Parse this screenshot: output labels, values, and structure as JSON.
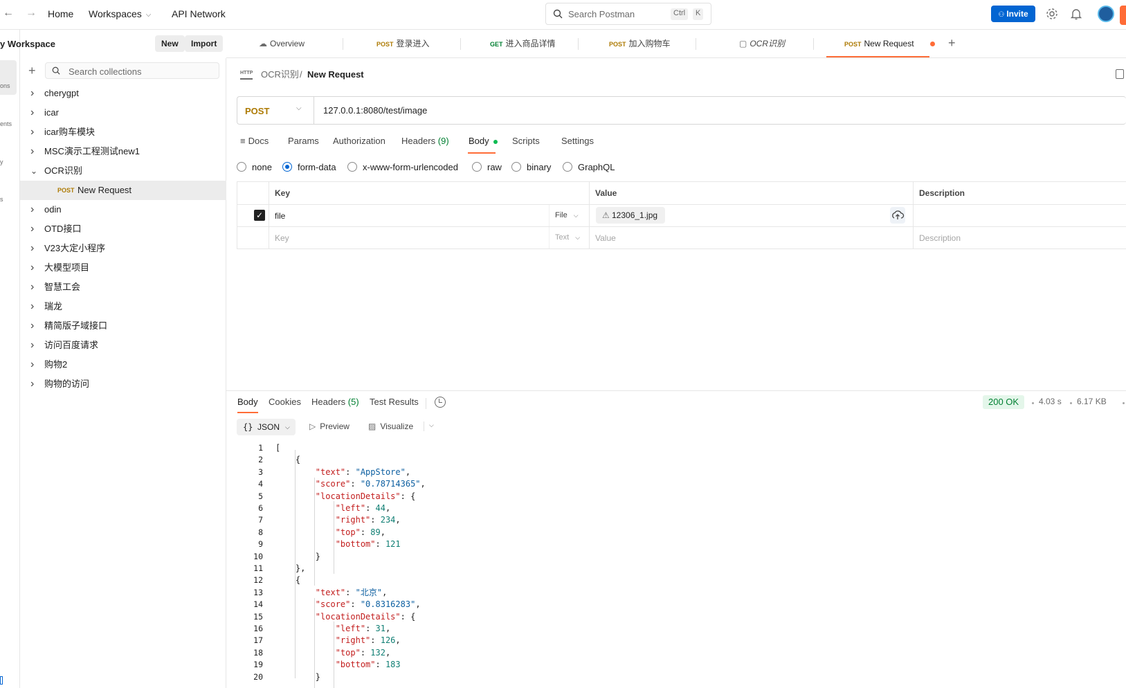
{
  "topbar": {
    "nav": [
      "Home",
      "Workspaces",
      "API Network"
    ],
    "search_placeholder": "Search Postman",
    "shortcut": [
      "Ctrl",
      "K"
    ],
    "invite_label": "Invite"
  },
  "sidebar": {
    "workspace_title": "y Workspace",
    "new_label": "New",
    "import_label": "Import",
    "rail_labels": [
      "ons",
      "ents",
      "y",
      "s"
    ],
    "search_placeholder": "Search collections",
    "collections": [
      {
        "name": "cherygpt",
        "expanded": false
      },
      {
        "name": "icar",
        "expanded": false
      },
      {
        "name": "icar购车模块",
        "expanded": false
      },
      {
        "name": "MSC演示工程测试new1",
        "expanded": false
      },
      {
        "name": "OCR识别",
        "expanded": true,
        "children": [
          {
            "method": "POST",
            "name": "New Request"
          }
        ]
      },
      {
        "name": "odin",
        "expanded": false
      },
      {
        "name": "OTD接口",
        "expanded": false
      },
      {
        "name": "V23大定小程序",
        "expanded": false
      },
      {
        "name": "大模型项目",
        "expanded": false
      },
      {
        "name": "智慧工会",
        "expanded": false
      },
      {
        "name": "瑞龙",
        "expanded": false
      },
      {
        "name": "精简版子域接口",
        "expanded": false
      },
      {
        "name": "访问百度请求",
        "expanded": false
      },
      {
        "name": "购物2",
        "expanded": false
      },
      {
        "name": "购物的访问",
        "expanded": false
      }
    ]
  },
  "tabs": [
    {
      "method": "",
      "label": "Overview"
    },
    {
      "method": "POST",
      "label": "登录进入"
    },
    {
      "method": "GET",
      "label": "进入商品详情"
    },
    {
      "method": "POST",
      "label": "加入购物车"
    },
    {
      "method": "",
      "label": "OCR识别"
    },
    {
      "method": "POST",
      "label": "New Request"
    }
  ],
  "breadcrumb": {
    "parent": "OCR识别",
    "sep": "/",
    "current": "New Request"
  },
  "request": {
    "method": "POST",
    "url": "127.0.0.1:8080/test/image",
    "tabs": {
      "docs": "Docs",
      "params": "Params",
      "authorization": "Authorization",
      "headers": "Headers",
      "headers_count": "(9)",
      "body": "Body",
      "scripts": "Scripts",
      "settings": "Settings"
    },
    "body_types": [
      "none",
      "form-data",
      "x-www-form-urlencoded",
      "raw",
      "binary",
      "GraphQL"
    ],
    "body_type_selected": "form-data",
    "table": {
      "headers": {
        "key": "Key",
        "value": "Value",
        "description": "Description"
      },
      "rows": [
        {
          "key": "file",
          "type": "File",
          "value": "12306_1.jpg",
          "description": ""
        }
      ],
      "empty_row": {
        "key": "Key",
        "type": "Text",
        "value": "Value",
        "description": "Description"
      }
    }
  },
  "response": {
    "tabs": {
      "body": "Body",
      "cookies": "Cookies",
      "headers": "Headers",
      "headers_count": "(5)",
      "test_results": "Test Results"
    },
    "status": "200 OK",
    "time": "4.03 s",
    "size": "6.17 KB",
    "format": "JSON",
    "preview_label": "Preview",
    "visualize_label": "Visualize",
    "lines": [
      "[",
      "    {",
      "        \"text\": \"AppStore\",",
      "        \"score\": \"0.78714365\",",
      "        \"locationDetails\": {",
      "            \"left\": 44,",
      "            \"right\": 234,",
      "            \"top\": 89,",
      "            \"bottom\": 121",
      "        }",
      "    },",
      "    {",
      "        \"text\": \"北京\",",
      "        \"score\": \"0.8316283\",",
      "        \"locationDetails\": {",
      "            \"left\": 31,",
      "            \"right\": 126,",
      "            \"top\": 132,",
      "            \"bottom\": 183",
      "        }"
    ]
  },
  "colors": {
    "accent": "#ff6c37",
    "primary": "#0265d2",
    "post": "#ad7a03",
    "get": "#007f31",
    "success": "#007f31"
  }
}
